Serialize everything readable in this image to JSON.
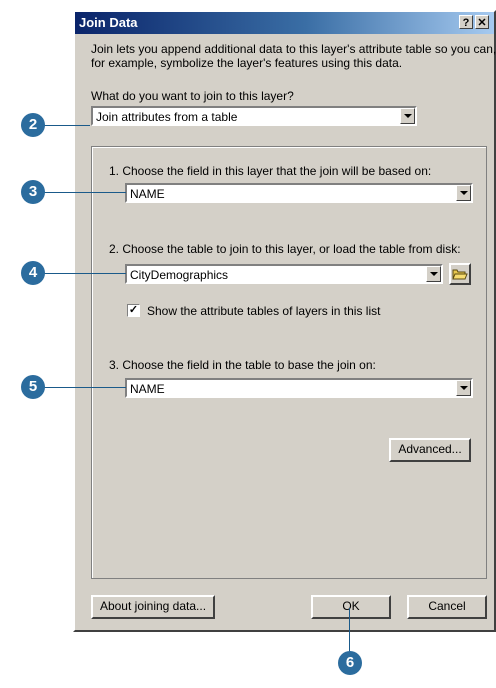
{
  "dialog": {
    "title": "Join Data",
    "help_button": "?",
    "close_button": "✕",
    "intro_text": "Join lets you append additional data to this layer's attribute table so you can, for example, symbolize the layer's features using this data.",
    "intro_line1": "Join lets you append additional data to this layer's attribute table so you can,",
    "intro_line2": "for example, symbolize the layer's features using this data.",
    "question": "What do you want to join to this layer?",
    "join_type": {
      "selected": "Join attributes from a table"
    },
    "step1": {
      "label": "1.  Choose the field in this layer that the join will be based on:",
      "selected": "NAME"
    },
    "step2": {
      "label": "2.  Choose the table to join to this layer, or load the table from disk:",
      "selected": "CityDemographics",
      "checkbox_label": "Show the attribute tables of layers in this list",
      "checkbox_checked": true,
      "checkbox_mark": "✓"
    },
    "step3": {
      "label": "3.  Choose the field in the table to base the join on:",
      "selected": "NAME"
    },
    "buttons": {
      "advanced": "Advanced...",
      "about": "About joining data...",
      "ok": "OK",
      "cancel": "Cancel"
    }
  },
  "callouts": {
    "c2": "2",
    "c3": "3",
    "c4": "4",
    "c5": "5",
    "c6": "6"
  },
  "colors": {
    "callout": "#2b6c9e",
    "titlebar": "#0a246a",
    "dialog_face": "#d4d0c8"
  }
}
